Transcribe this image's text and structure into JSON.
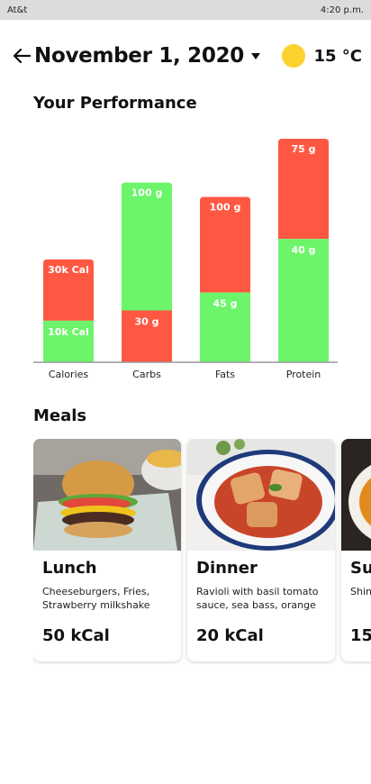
{
  "status": {
    "carrier": "At&t",
    "time": "4:20 p.m."
  },
  "header": {
    "date": "November 1, 2020",
    "temperature": "15 °C"
  },
  "sections": {
    "performance": "Your Performance",
    "meals": "Meals"
  },
  "colors": {
    "green": "#6cf46a",
    "red": "#ff5842",
    "sun": "#fcd22e"
  },
  "chart_data": {
    "type": "bar",
    "stacked": true,
    "categories": [
      "Calories",
      "Carbs",
      "Fats",
      "Protein"
    ],
    "segments": [
      {
        "bottom": {
          "label": "10k Cal",
          "color": "green",
          "fraction": 0.186
        },
        "top": {
          "label": "30k Cal",
          "color": "red",
          "fraction": 0.46
        }
      },
      {
        "bottom": {
          "label": "30 g",
          "color": "red",
          "fraction": 0.232
        },
        "top": {
          "label": "100 g",
          "color": "green",
          "fraction": 0.804
        }
      },
      {
        "bottom": {
          "label": "45 g",
          "color": "green",
          "fraction": 0.312
        },
        "top": {
          "label": "100 g",
          "color": "red",
          "fraction": 0.74
        }
      },
      {
        "bottom": {
          "label": "40 g",
          "color": "green",
          "fraction": 0.552
        },
        "top": {
          "label": "75 g",
          "color": "red",
          "fraction": 1.0
        }
      }
    ]
  },
  "meals": [
    {
      "name": "Lunch",
      "description": "Cheeseburgers, Fries, Strawberry milkshake",
      "kcal": "50 kCal",
      "image": "burger-photo"
    },
    {
      "name": "Dinner",
      "description": "Ravioli with basil tomato sauce, sea bass, orange",
      "kcal": "20 kCal",
      "image": "ravioli-photo"
    },
    {
      "name": "Su",
      "description": "Shin",
      "kcal": "15",
      "image": "soup-photo"
    }
  ]
}
